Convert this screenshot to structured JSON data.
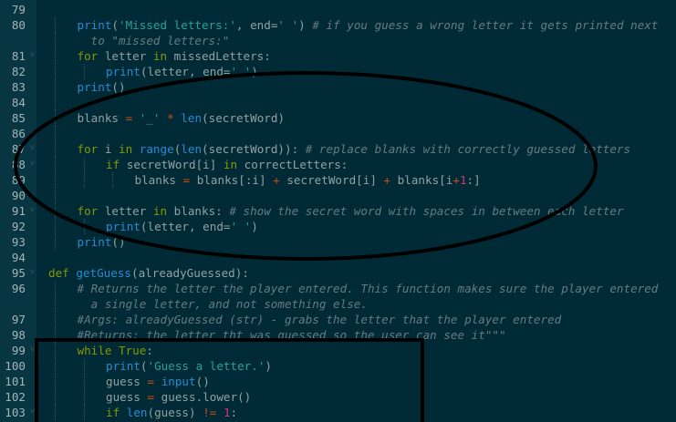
{
  "lines": [
    {
      "n": "79",
      "fold": false,
      "indent": 0,
      "tokens": []
    },
    {
      "n": "80",
      "fold": false,
      "indent": 1,
      "tokens": [
        [
          "fn",
          "print"
        ],
        [
          "p",
          "("
        ],
        [
          "str",
          "'Missed letters:'"
        ],
        [
          "p",
          ", end="
        ],
        [
          "str",
          "' '"
        ],
        [
          "p",
          ") "
        ],
        [
          "cm",
          "# if you guess a wrong letter it gets printed next"
        ]
      ]
    },
    {
      "n": "",
      "fold": false,
      "indent": 1,
      "tokens": [
        [
          "cm",
          "  to \"missed letters:\""
        ]
      ]
    },
    {
      "n": "81",
      "fold": true,
      "indent": 1,
      "tokens": [
        [
          "kw",
          "for"
        ],
        [
          "p",
          " letter "
        ],
        [
          "kw",
          "in"
        ],
        [
          "p",
          " missedLetters:"
        ]
      ]
    },
    {
      "n": "82",
      "fold": false,
      "indent": 2,
      "tokens": [
        [
          "fn",
          "print"
        ],
        [
          "p",
          "(letter, end="
        ],
        [
          "str",
          "' '"
        ],
        [
          "p",
          ")"
        ]
      ]
    },
    {
      "n": "83",
      "fold": false,
      "indent": 1,
      "tokens": [
        [
          "fn",
          "print"
        ],
        [
          "p",
          "()"
        ]
      ]
    },
    {
      "n": "84",
      "fold": false,
      "indent": 1,
      "tokens": []
    },
    {
      "n": "85",
      "fold": false,
      "indent": 1,
      "tokens": [
        [
          "p",
          "blanks "
        ],
        [
          "op",
          "="
        ],
        [
          "p",
          " "
        ],
        [
          "str",
          "'_'"
        ],
        [
          "p",
          " "
        ],
        [
          "op",
          "*"
        ],
        [
          "p",
          " "
        ],
        [
          "fn",
          "len"
        ],
        [
          "p",
          "(secretWord)"
        ]
      ]
    },
    {
      "n": "86",
      "fold": false,
      "indent": 1,
      "tokens": []
    },
    {
      "n": "87",
      "fold": true,
      "indent": 1,
      "tokens": [
        [
          "kw",
          "for"
        ],
        [
          "p",
          " i "
        ],
        [
          "kw",
          "in"
        ],
        [
          "p",
          " "
        ],
        [
          "fn",
          "range"
        ],
        [
          "p",
          "("
        ],
        [
          "fn",
          "len"
        ],
        [
          "p",
          "(secretWord)): "
        ],
        [
          "cm",
          "# replace blanks with correctly guessed letters"
        ]
      ]
    },
    {
      "n": "88",
      "fold": true,
      "indent": 2,
      "tokens": [
        [
          "kw",
          "if"
        ],
        [
          "p",
          " secretWord[i] "
        ],
        [
          "kw",
          "in"
        ],
        [
          "p",
          " correctLetters:"
        ]
      ]
    },
    {
      "n": "89",
      "fold": false,
      "indent": 3,
      "tokens": [
        [
          "p",
          "blanks "
        ],
        [
          "op",
          "="
        ],
        [
          "p",
          " blanks[:i] "
        ],
        [
          "op",
          "+"
        ],
        [
          "p",
          " secretWord[i] "
        ],
        [
          "op",
          "+"
        ],
        [
          "p",
          " blanks[i"
        ],
        [
          "op",
          "+"
        ],
        [
          "num",
          "1"
        ],
        [
          "p",
          ":]"
        ]
      ]
    },
    {
      "n": "90",
      "fold": false,
      "indent": 1,
      "tokens": []
    },
    {
      "n": "91",
      "fold": true,
      "indent": 1,
      "tokens": [
        [
          "kw",
          "for"
        ],
        [
          "p",
          " letter "
        ],
        [
          "kw",
          "in"
        ],
        [
          "p",
          " blanks: "
        ],
        [
          "cm",
          "# show the secret word with spaces in between each letter"
        ]
      ]
    },
    {
      "n": "92",
      "fold": false,
      "indent": 2,
      "tokens": [
        [
          "fn",
          "print"
        ],
        [
          "p",
          "(letter, end="
        ],
        [
          "str",
          "' '"
        ],
        [
          "p",
          ")"
        ]
      ]
    },
    {
      "n": "93",
      "fold": false,
      "indent": 1,
      "tokens": [
        [
          "fn",
          "print"
        ],
        [
          "p",
          "()"
        ]
      ]
    },
    {
      "n": "94",
      "fold": false,
      "indent": 0,
      "tokens": []
    },
    {
      "n": "95",
      "fold": true,
      "indent": 0,
      "tokens": [
        [
          "kw",
          "def"
        ],
        [
          "p",
          " "
        ],
        [
          "fn",
          "getGuess"
        ],
        [
          "p",
          "(alreadyGuessed):"
        ]
      ]
    },
    {
      "n": "96",
      "fold": false,
      "indent": 1,
      "tokens": [
        [
          "cm",
          "# Returns the letter the player entered. This function makes sure the player entered"
        ]
      ]
    },
    {
      "n": "",
      "fold": false,
      "indent": 1,
      "tokens": [
        [
          "cm",
          "  a single letter, and not something else."
        ]
      ]
    },
    {
      "n": "97",
      "fold": false,
      "indent": 1,
      "tokens": [
        [
          "cm",
          "#Args: alreadyGuessed (str) - grabs the letter that the player entered"
        ]
      ]
    },
    {
      "n": "98",
      "fold": false,
      "indent": 1,
      "tokens": [
        [
          "cm",
          "#Returns: the letter tht was guessed so the user can see it\"\"\""
        ]
      ]
    },
    {
      "n": "99",
      "fold": true,
      "indent": 1,
      "tokens": [
        [
          "kw",
          "while"
        ],
        [
          "p",
          " "
        ],
        [
          "kw",
          "True"
        ],
        [
          "p",
          ":"
        ]
      ]
    },
    {
      "n": "100",
      "fold": false,
      "indent": 2,
      "tokens": [
        [
          "fn",
          "print"
        ],
        [
          "p",
          "("
        ],
        [
          "str",
          "'Guess a letter.'"
        ],
        [
          "p",
          ")"
        ]
      ]
    },
    {
      "n": "101",
      "fold": false,
      "indent": 2,
      "tokens": [
        [
          "p",
          "guess "
        ],
        [
          "op",
          "="
        ],
        [
          "p",
          " "
        ],
        [
          "fn",
          "input"
        ],
        [
          "p",
          "()"
        ]
      ]
    },
    {
      "n": "102",
      "fold": false,
      "indent": 2,
      "tokens": [
        [
          "p",
          "guess "
        ],
        [
          "op",
          "="
        ],
        [
          "p",
          " guess.lower()"
        ]
      ]
    },
    {
      "n": "103",
      "fold": true,
      "indent": 2,
      "tokens": [
        [
          "kw",
          "if"
        ],
        [
          "p",
          " "
        ],
        [
          "fn",
          "len"
        ],
        [
          "p",
          "(guess) "
        ],
        [
          "op",
          "!="
        ],
        [
          "p",
          " "
        ],
        [
          "num",
          "1"
        ],
        [
          "p",
          ":"
        ]
      ]
    }
  ],
  "fold_glyph": "˅",
  "colors": {
    "background": "#002b36",
    "gutter": "#073642",
    "keyword": "#859900",
    "function": "#268bd2",
    "string": "#2aa198",
    "comment": "#657b83",
    "number": "#d33682",
    "annotation": "#000000"
  }
}
